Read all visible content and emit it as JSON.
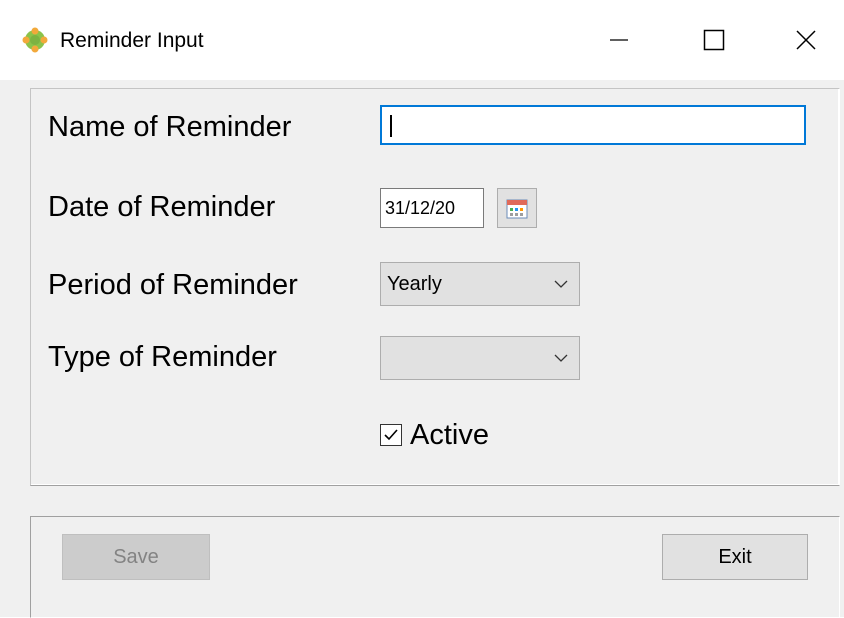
{
  "window": {
    "title": "Reminder Input",
    "icon": "reminder-app-icon",
    "controls": [
      "minimize-icon",
      "maximize-icon",
      "close-icon"
    ]
  },
  "form": {
    "name_label": "Name of Reminder",
    "name_value": "",
    "date_label": "Date of Reminder",
    "date_value": "31/12/20",
    "period_label": "Period of Reminder",
    "period_value": "Yearly",
    "type_label": "Type of Reminder",
    "type_value": "",
    "active_label": "Active",
    "active_checked": true
  },
  "buttons": {
    "save_label": "Save",
    "save_enabled": false,
    "exit_label": "Exit"
  },
  "colors": {
    "focus_border": "#0078d7",
    "window_bg": "#f0f0f0",
    "button_bg": "#e1e1e1"
  }
}
